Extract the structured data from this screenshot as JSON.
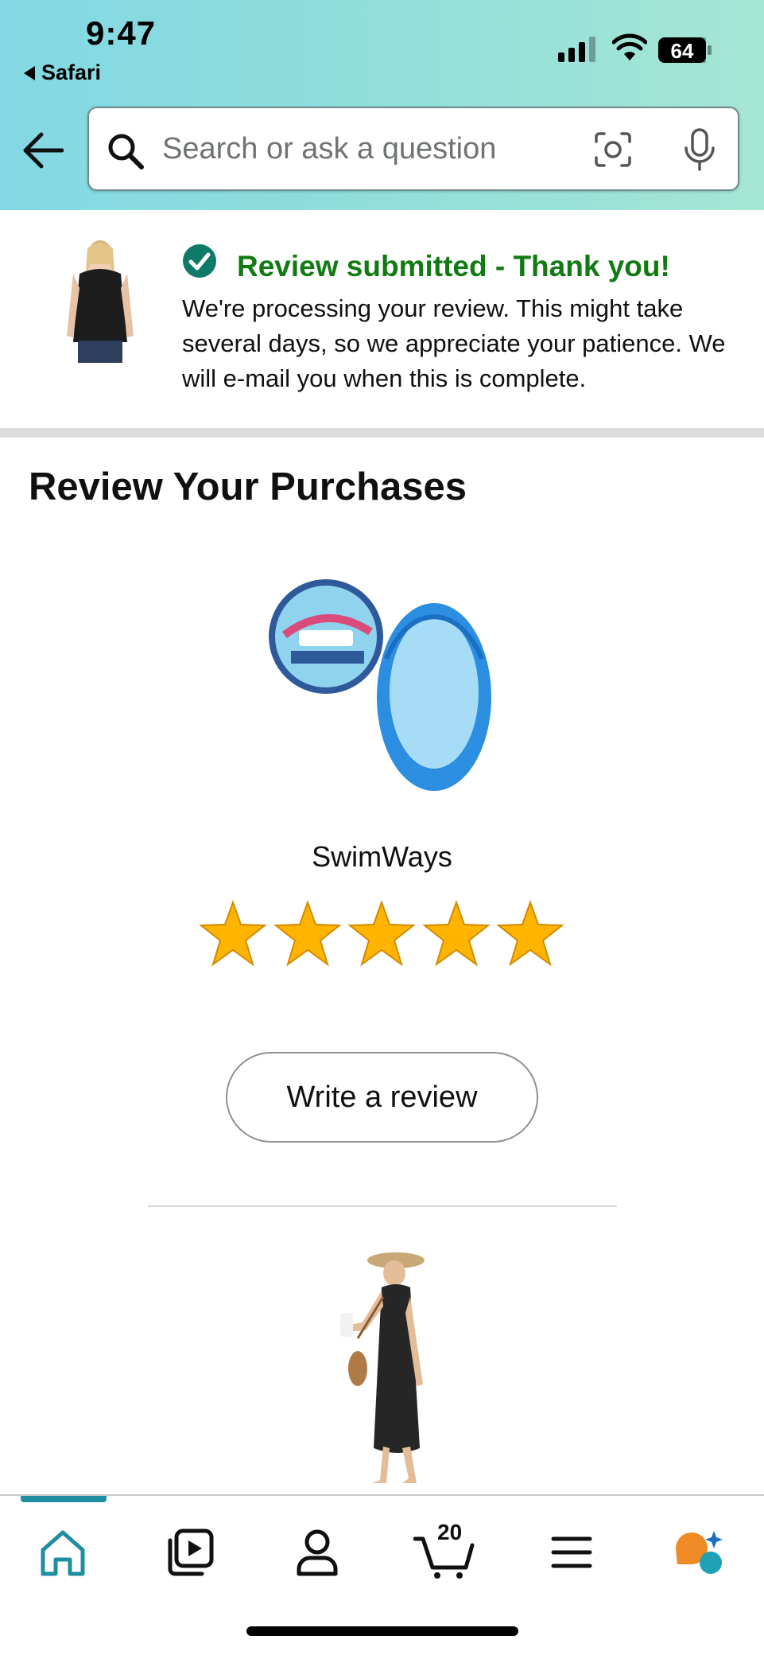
{
  "status_bar": {
    "time": "9:47",
    "back_app": "Safari",
    "battery": "64"
  },
  "search": {
    "placeholder": "Search or ask a question"
  },
  "notice": {
    "title": "Review submitted - Thank you!",
    "body": "We're processing your review. This might take several days, so we appreciate your patience. We will e-mail you when this is complete.",
    "title_color": "#117a12",
    "check_color": "#0f7a6a"
  },
  "section": {
    "title": "Review Your Purchases"
  },
  "products": [
    {
      "name": "SwimWays",
      "rating": 5,
      "max_rating": 5,
      "button_label": "Write a review"
    },
    {
      "name": ""
    }
  ],
  "bottom_nav": {
    "items": [
      "home-icon",
      "video-icon",
      "account-icon",
      "cart-icon",
      "menu-icon",
      "rufus-icon"
    ],
    "cart_count": "20",
    "active_color": "#1f8ea0",
    "accent_color": "#f08a24"
  },
  "colors": {
    "header_gradient_start": "#82d8e3",
    "header_gradient_end": "#a6e6d4",
    "star_fill": "#ffb400"
  }
}
